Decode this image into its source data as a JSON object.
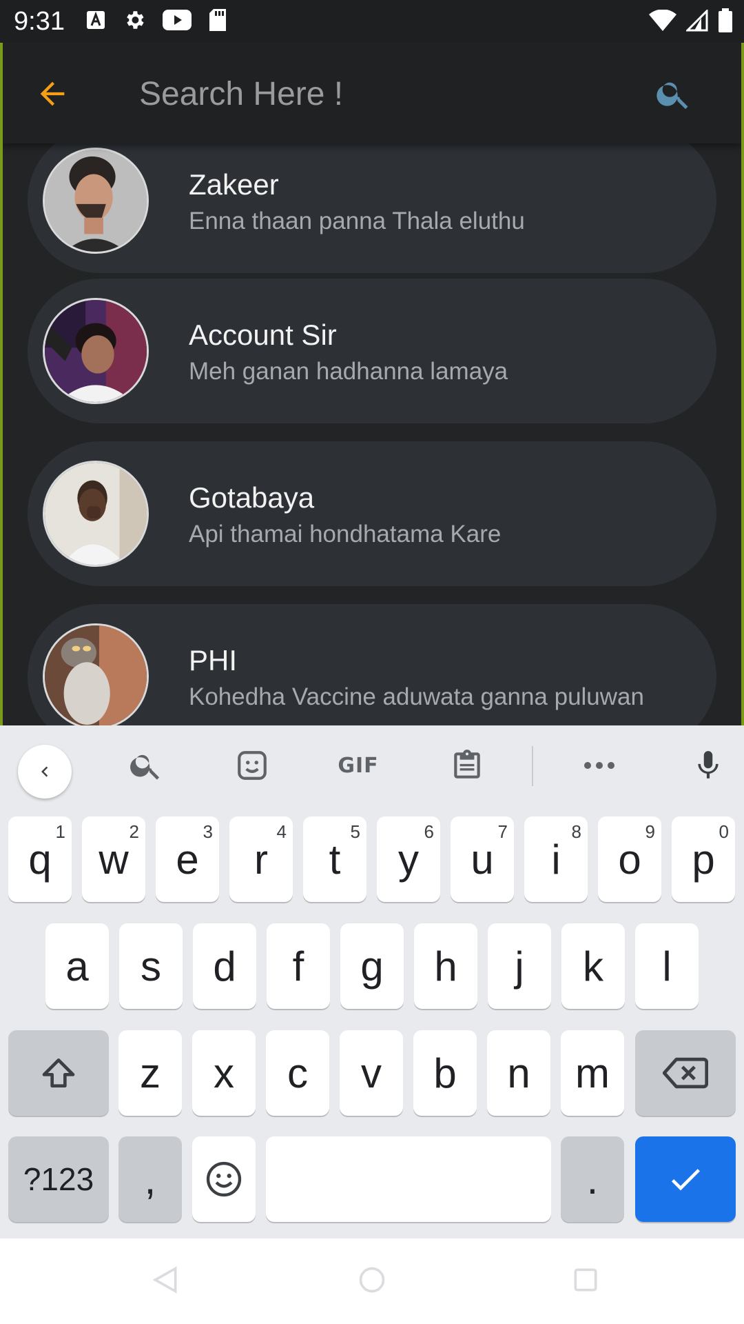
{
  "status_bar": {
    "time": "9:31"
  },
  "search": {
    "placeholder": "Search Here !",
    "value": ""
  },
  "chats": [
    {
      "name": "Zakeer",
      "message": "Enna thaan panna Thala eluthu"
    },
    {
      "name": "Account Sir",
      "message": "Meh ganan hadhanna lamaya"
    },
    {
      "name": "Gotabaya",
      "message": "Api thamai hondhatama Kare"
    },
    {
      "name": "PHI",
      "message": "Kohedha Vaccine aduwata ganna puluwan"
    }
  ],
  "keyboard": {
    "toolbar": {
      "gif_label": "GIF"
    },
    "row1": [
      {
        "key": "q",
        "hint": "1"
      },
      {
        "key": "w",
        "hint": "2"
      },
      {
        "key": "e",
        "hint": "3"
      },
      {
        "key": "r",
        "hint": "4"
      },
      {
        "key": "t",
        "hint": "5"
      },
      {
        "key": "y",
        "hint": "6"
      },
      {
        "key": "u",
        "hint": "7"
      },
      {
        "key": "i",
        "hint": "8"
      },
      {
        "key": "o",
        "hint": "9"
      },
      {
        "key": "p",
        "hint": "0"
      }
    ],
    "row2": [
      "a",
      "s",
      "d",
      "f",
      "g",
      "h",
      "j",
      "k",
      "l"
    ],
    "row3": [
      "z",
      "x",
      "c",
      "v",
      "b",
      "n",
      "m"
    ],
    "symbols_label": "?123",
    "comma_label": ",",
    "period_label": "."
  },
  "colors": {
    "accent_orange": "#f59f17",
    "search_icon_blue": "#5b8fb0",
    "app_background": "#222426",
    "chat_card": "#2d3136",
    "keyboard_action_blue": "#1a73e8"
  }
}
